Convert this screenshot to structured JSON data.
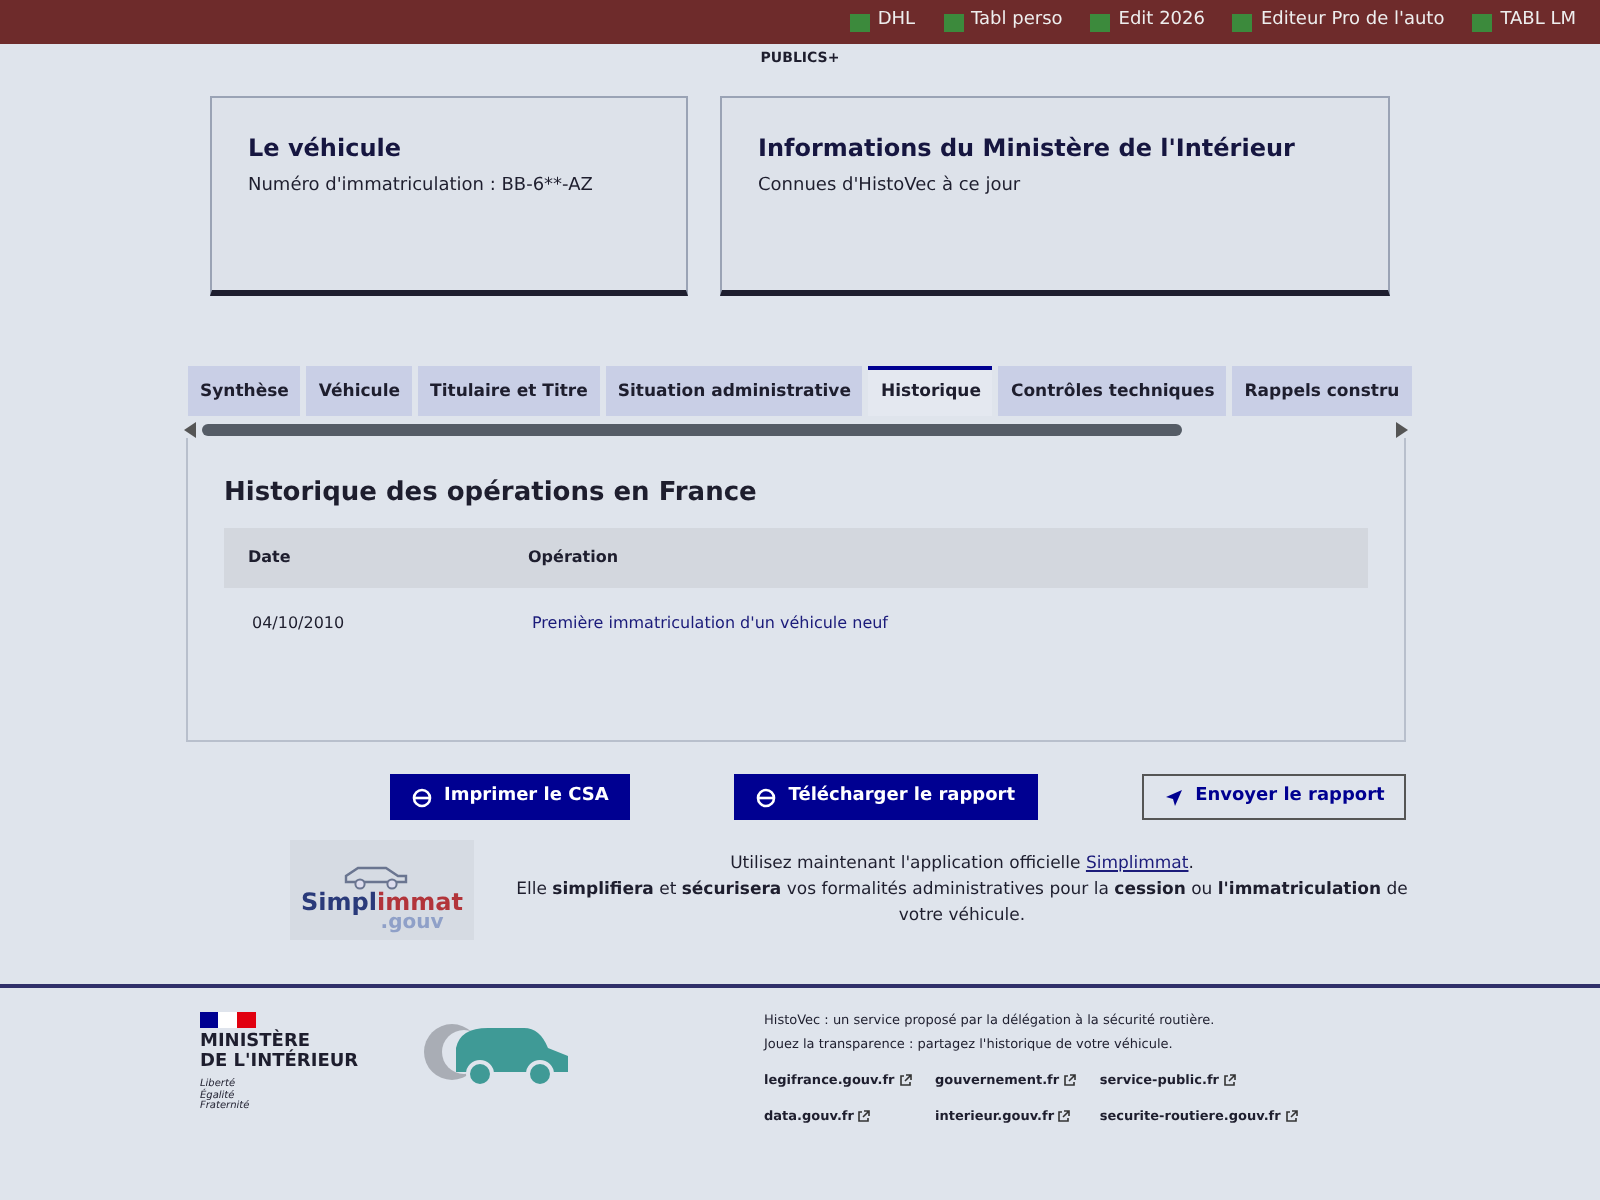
{
  "bookmarks": [
    {
      "label": "DHL"
    },
    {
      "label": "Tabl perso"
    },
    {
      "label": "Edit 2026"
    },
    {
      "label": "Editeur Pro de l'auto"
    },
    {
      "label": "TABL LM"
    }
  ],
  "header": {
    "logo_text": "PUBLICS+"
  },
  "cards": [
    {
      "title": "Le véhicule",
      "text": "Numéro d'immatriculation : BB-6**-AZ"
    },
    {
      "title": "Informations du Ministère de l'Intérieur",
      "text": "Connues d'HistoVec à ce jour"
    }
  ],
  "tabs": [
    {
      "label": "Synthèse",
      "selected": false
    },
    {
      "label": "Véhicule",
      "selected": false
    },
    {
      "label": "Titulaire et Titre",
      "selected": false
    },
    {
      "label": "Situation administrative",
      "selected": false
    },
    {
      "label": "Historique",
      "selected": true
    },
    {
      "label": "Contrôles techniques",
      "selected": false
    },
    {
      "label": "Rappels constru",
      "selected": false
    }
  ],
  "section": {
    "title": "Historique des opérations en France",
    "columns": [
      "Date",
      "Opération"
    ],
    "rows": [
      {
        "date": "04/10/2010",
        "operation": "Première immatriculation d'un véhicule neuf"
      }
    ]
  },
  "buttons": [
    {
      "label": "Imprimer le CSA",
      "kind": "primary"
    },
    {
      "label": "Télécharger le rapport",
      "kind": "primary"
    },
    {
      "label": "Envoyer le rapport",
      "kind": "secondary"
    }
  ],
  "promo": {
    "logo_main": "Simpl",
    "logo_accent": "immat",
    "logo_sub": ".gouv",
    "text_before": "Utilisez maintenant l'application officielle",
    "link": "Simplimmat",
    "text_after": ".",
    "text_2": "Elle **simplifiera** et **sécurisera** vos formalités administratives pour la **cession** ou **l'immatriculation** de votre véhicule."
  },
  "footer": {
    "ministry": [
      "MINISTÈRE",
      "DE L'INTÉRIEUR"
    ],
    "motto": [
      "Liberté",
      "Égalité",
      "Fraternité"
    ],
    "description": [
      "HistoVec : un service proposé par la délégation à la sécurité routière.",
      "Jouez la transparence : partagez l'historique de votre véhicule."
    ],
    "links": [
      {
        "label": "legifrance.gouv.fr"
      },
      {
        "label": "gouvernement.fr"
      },
      {
        "label": "service-public.fr"
      },
      {
        "label": "data.gouv.fr"
      },
      {
        "label": "interieur.gouv.fr"
      },
      {
        "label": "securite-routiere.gouv.fr"
      }
    ]
  }
}
